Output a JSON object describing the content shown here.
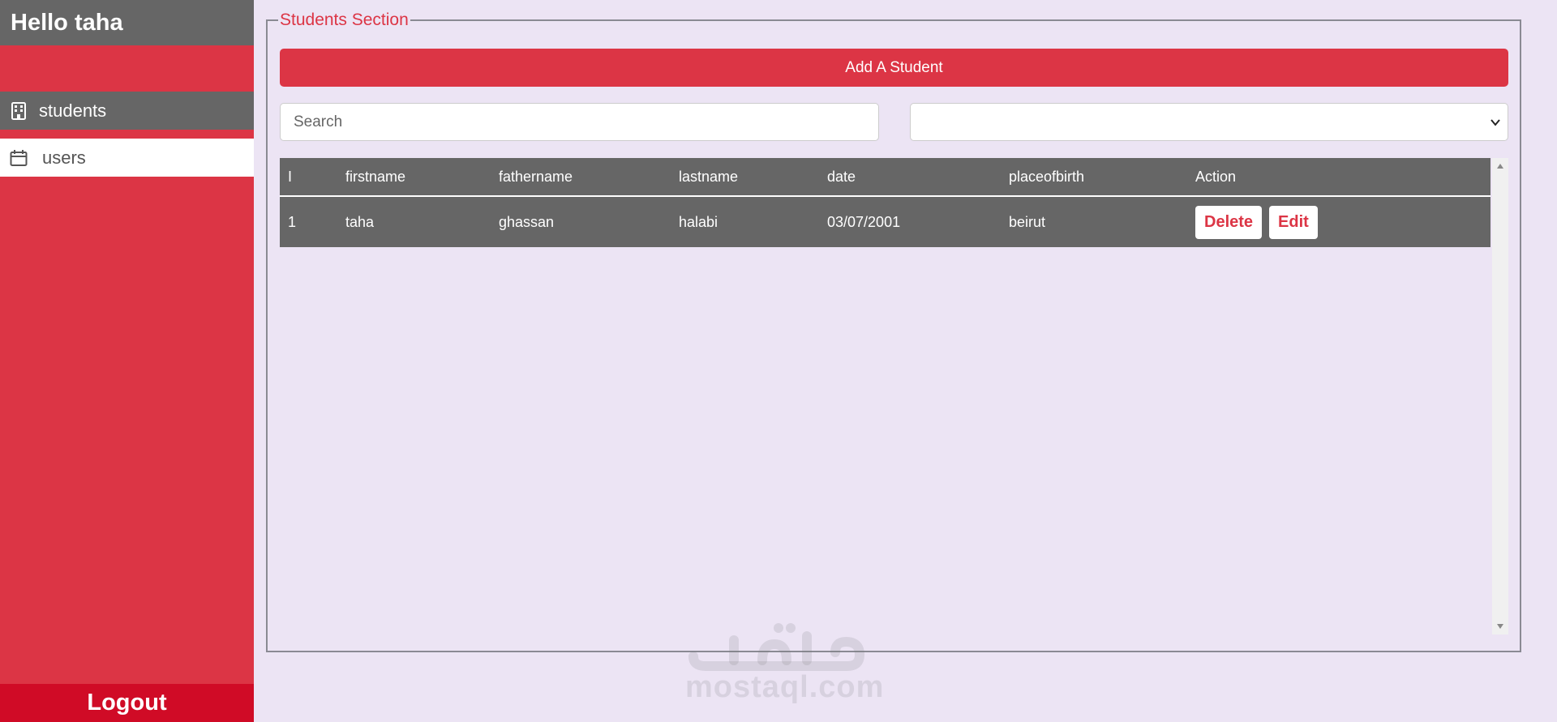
{
  "sidebar": {
    "greeting": "Hello taha",
    "items": [
      {
        "label": "students",
        "icon": "building-icon"
      },
      {
        "label": "users",
        "icon": "calendar-icon"
      }
    ],
    "logout_label": "Logout"
  },
  "section": {
    "title": "Students Section",
    "add_button_label": "Add A Student",
    "search_placeholder": "Search",
    "select_value": ""
  },
  "table": {
    "headers": [
      "I",
      "firstname",
      "fathername",
      "lastname",
      "date",
      "placeofbirth",
      "Action"
    ],
    "rows": [
      {
        "id": "1",
        "firstname": "taha",
        "fathername": "ghassan",
        "lastname": "halabi",
        "date": "03/07/2001",
        "placeofbirth": "beirut",
        "delete_label": "Delete",
        "edit_label": "Edit"
      }
    ]
  },
  "watermark": {
    "brand": "mostaql.com"
  },
  "colors": {
    "accent": "#dc3545",
    "header": "#666666",
    "background": "#ece4f4",
    "logout": "#d00b26"
  }
}
